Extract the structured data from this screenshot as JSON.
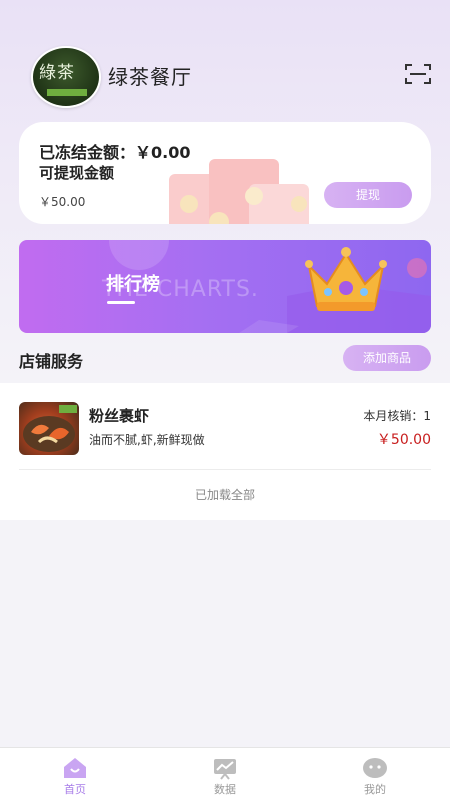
{
  "header": {
    "store_name": "绿茶餐厅",
    "avatar_logo_text": "綠茶",
    "scan_icon": "scan-icon"
  },
  "balance": {
    "frozen_label": "已冻结金额：",
    "frozen_value": "¥0.00",
    "frozen_text": "已冻结金额：￥0.00",
    "withdrawable_label": "可提现金额",
    "withdrawable_value": "￥50.00",
    "withdraw_button": "提现"
  },
  "banner": {
    "title": "排行榜",
    "subtitle": "THE CHARTS."
  },
  "services": {
    "title": "店铺服务",
    "add_button": "添加商品"
  },
  "products": [
    {
      "name": "粉丝裹虾",
      "description": "油而不腻,虾,新鲜现做",
      "monthly_sales": "本月核销：1",
      "price": "￥50.00"
    }
  ],
  "list_footer": "已加载全部",
  "tabbar": {
    "items": [
      {
        "label": "首页",
        "icon": "home-icon",
        "active": true
      },
      {
        "label": "数据",
        "icon": "chart-icon",
        "active": false
      },
      {
        "label": "我的",
        "icon": "profile-icon",
        "active": false
      }
    ]
  },
  "colors": {
    "accent": "#c99cef",
    "price": "#c81e1e",
    "tab_active": "#a87de8"
  }
}
